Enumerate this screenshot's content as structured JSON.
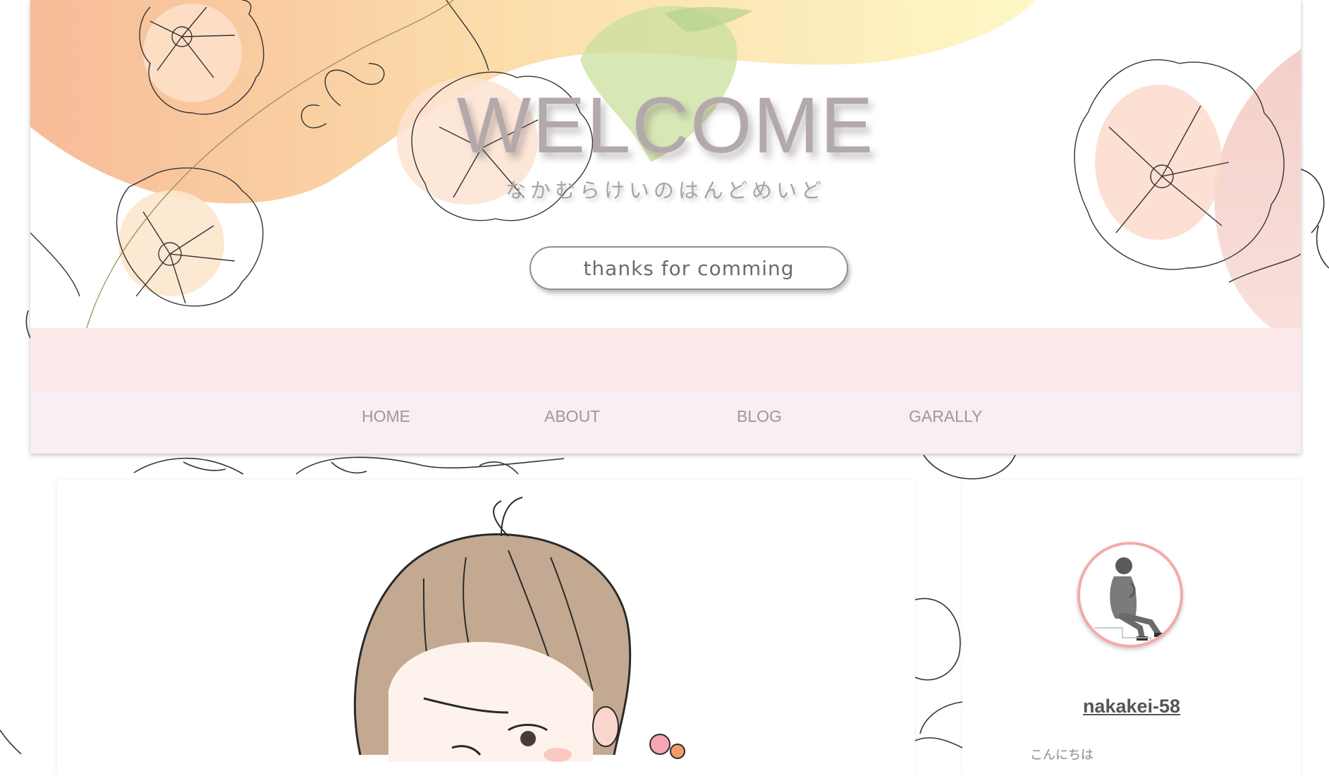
{
  "hero": {
    "title": "WELCOME",
    "subtitle": "なかむらけいのはんどめいど",
    "cta_label": "thanks for comming"
  },
  "nav": {
    "items": [
      {
        "label": "HOME"
      },
      {
        "label": "ABOUT"
      },
      {
        "label": "BLOG"
      },
      {
        "label": "GARALLY"
      }
    ]
  },
  "profile": {
    "username": "nakakei-58",
    "bio_snippet": "こんにちは"
  },
  "colors": {
    "nav_pink": "#fde9ea",
    "nav_lavender": "#f8eef4",
    "avatar_border": "#f4aaa8",
    "text_gray": "#9e989a"
  }
}
